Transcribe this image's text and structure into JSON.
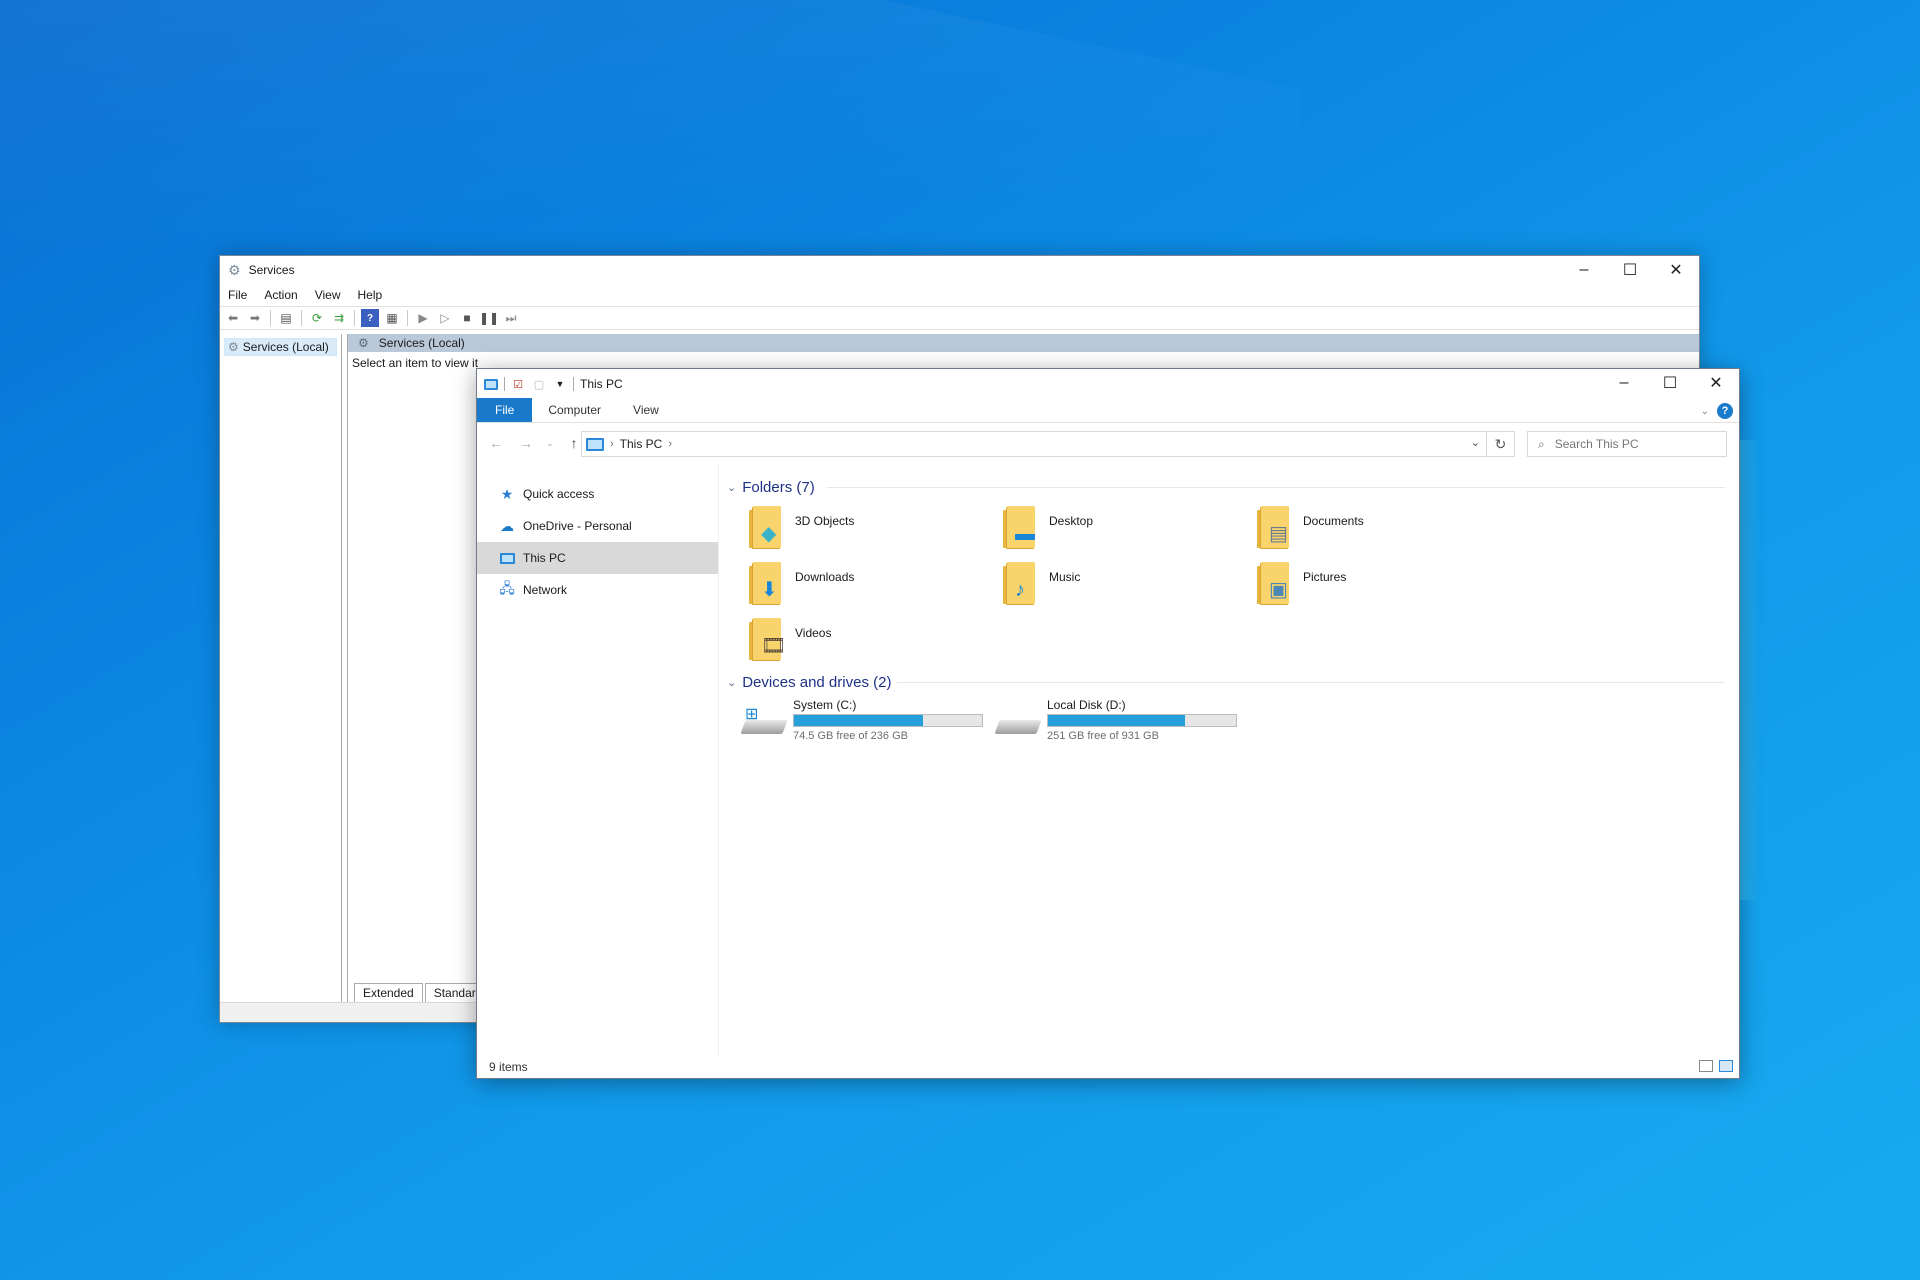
{
  "services": {
    "title": "Services",
    "menu": [
      "File",
      "Action",
      "View",
      "Help"
    ],
    "tree_item": "Services (Local)",
    "header": "Services (Local)",
    "description": "Select an item to view it",
    "tabs": [
      "Extended",
      "Standard"
    ]
  },
  "explorer": {
    "title": "This PC",
    "ribbon_tabs": [
      "File",
      "Computer",
      "View"
    ],
    "address": {
      "crumb": "This PC"
    },
    "search": {
      "placeholder": "Search This PC"
    },
    "nav": [
      {
        "label": "Quick access",
        "icon": "star-icon"
      },
      {
        "label": "OneDrive - Personal",
        "icon": "cloud-icon"
      },
      {
        "label": "This PC",
        "icon": "pc-icon"
      },
      {
        "label": "Network",
        "icon": "network-icon"
      }
    ],
    "folders_header": "Folders (7)",
    "folders": [
      {
        "name": "3D Objects",
        "icon": "cube-icon"
      },
      {
        "name": "Desktop",
        "icon": "desktop-icon"
      },
      {
        "name": "Documents",
        "icon": "document-icon"
      },
      {
        "name": "Downloads",
        "icon": "download-arrow-icon"
      },
      {
        "name": "Music",
        "icon": "music-note-icon"
      },
      {
        "name": "Pictures",
        "icon": "picture-icon"
      },
      {
        "name": "Videos",
        "icon": "film-icon"
      }
    ],
    "drives_header": "Devices and drives (2)",
    "drives": [
      {
        "name": "System (C:)",
        "free": "74.5 GB free of 236 GB",
        "used_fraction": 0.684
      },
      {
        "name": "Local Disk (D:)",
        "free": "251 GB free of 931 GB",
        "used_fraction": 0.73
      }
    ],
    "status": "9 items"
  },
  "colors": {
    "accent": "#1979ca",
    "bar": "#26a0da",
    "group_header": "#1e3287"
  }
}
